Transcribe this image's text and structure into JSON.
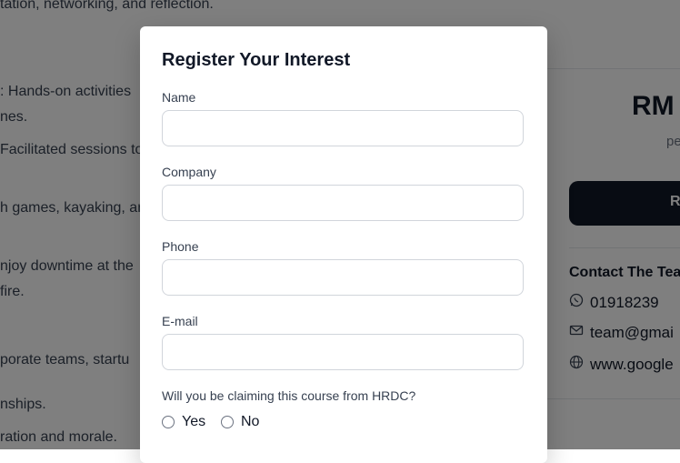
{
  "background": {
    "lines": [
      "tation, networking, and reflection.",
      ": Hands-on activities",
      "nes.",
      "Facilitated sessions to",
      "h games, kayaking, ar",
      "njoy downtime at the",
      "fire.",
      "porate teams, startu",
      "nships.",
      "ration and morale."
    ],
    "price": "RM",
    "per_label": "pe",
    "register_button_label": "R",
    "contact": {
      "title": "Contact The Tea",
      "phone": "01918239",
      "email": "team@gmai",
      "website": "www.google"
    }
  },
  "modal": {
    "title": "Register Your Interest",
    "fields": [
      {
        "label": "Name",
        "value": "",
        "placeholder": ""
      },
      {
        "label": "Company",
        "value": "",
        "placeholder": ""
      },
      {
        "label": "Phone",
        "value": "",
        "placeholder": ""
      },
      {
        "label": "E-mail",
        "value": "",
        "placeholder": ""
      }
    ],
    "hrdc_question": "Will you be claiming this course from HRDC?",
    "options": [
      "Yes",
      "No"
    ]
  },
  "colors": {
    "overlay": "rgba(0,0,0,0.5)",
    "primary_button": "#111827",
    "input_border": "#d1d5db"
  },
  "icons": [
    "whatsapp-icon",
    "mail-icon",
    "globe-icon"
  ]
}
